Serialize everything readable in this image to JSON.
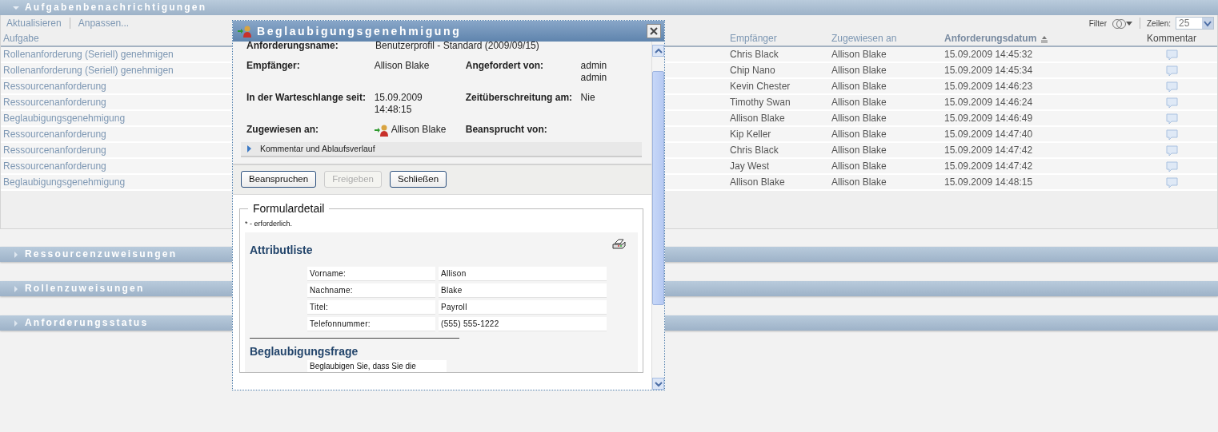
{
  "task_panel": {
    "title": "Aufgabenbenachrichtigungen",
    "expanded": true,
    "toolbar": [
      "Aktualisieren",
      "Anpassen..."
    ],
    "filter_label": "Filter",
    "rows_label": "Zeilen:",
    "rows_value": "25",
    "columns": [
      {
        "label": "Aufgabe",
        "kind": "sortable",
        "sorted": false
      },
      {
        "label": "Empfänger",
        "kind": "sortable",
        "sorted": false
      },
      {
        "label": "Zugewiesen an",
        "kind": "sortable",
        "sorted": false
      },
      {
        "label": "Anforderungsdatum",
        "kind": "sortable",
        "sorted": true
      },
      {
        "label": "Kommentar",
        "kind": "plain",
        "sorted": false
      }
    ],
    "rows": [
      {
        "task": "Rollenanforderung (Seriell) genehmigen",
        "recipient": "Chris Black",
        "assigned_to": "Allison Blake",
        "date": "15.09.2009 14:45:32"
      },
      {
        "task": "Rollenanforderung (Seriell) genehmigen",
        "recipient": "Chip Nano",
        "assigned_to": "Allison Blake",
        "date": "15.09.2009 14:45:34"
      },
      {
        "task": "Ressourcenanforderung",
        "recipient": "Kevin Chester",
        "assigned_to": "Allison Blake",
        "date": "15.09.2009 14:46:23"
      },
      {
        "task": "Ressourcenanforderung",
        "recipient": "Timothy Swan",
        "assigned_to": "Allison Blake",
        "date": "15.09.2009 14:46:24"
      },
      {
        "task": "Beglaubigungsgenehmigung",
        "recipient": "Allison Blake",
        "assigned_to": "Allison Blake",
        "date": "15.09.2009 14:46:49"
      },
      {
        "task": "Ressourcenanforderung",
        "recipient": "Kip Keller",
        "assigned_to": "Allison Blake",
        "date": "15.09.2009 14:47:40"
      },
      {
        "task": "Ressourcenanforderung",
        "recipient": "Chris Black",
        "assigned_to": "Allison Blake",
        "date": "15.09.2009 14:47:42"
      },
      {
        "task": "Ressourcenanforderung",
        "recipient": "Jay West",
        "assigned_to": "Allison Blake",
        "date": "15.09.2009 14:47:42"
      },
      {
        "task": "Beglaubigungsgenehmigung",
        "recipient": "Allison Blake",
        "assigned_to": "Allison Blake",
        "date": "15.09.2009 14:48:15"
      }
    ]
  },
  "collapsed_panels": [
    {
      "title": "Ressourcenzuweisungen",
      "expanded": false
    },
    {
      "title": "Rollenzuweisungen",
      "expanded": false
    },
    {
      "title": "Anforderungsstatus",
      "expanded": false
    }
  ],
  "dialog": {
    "title": "Beglaubigungsgenehmigung",
    "request_name": {
      "label": "Anforderungsname:",
      "value": "Benutzerprofil - Standard (2009/09/15)"
    },
    "details": [
      [
        {
          "label": "Empfänger:",
          "lines": [
            "Allison Blake"
          ],
          "kind": "text"
        },
        {
          "label": "Angefordert von:",
          "lines": [
            "admin",
            "admin"
          ],
          "kind": "text"
        }
      ],
      [
        {
          "label": "In der Warteschlange seit:",
          "lines": [
            "15.09.2009",
            "14:48:15"
          ],
          "kind": "text"
        },
        {
          "label": "Zeitüberschreitung am:",
          "lines": [
            "Nie"
          ],
          "kind": "text"
        }
      ],
      [
        {
          "label": "Zugewiesen an:",
          "lines": [
            "Allison Blake"
          ],
          "kind": "user"
        },
        {
          "label": "Beansprucht von:",
          "kind": "text"
        }
      ]
    ],
    "history": {
      "label": "Kommentar und Ablaufsverlauf",
      "expanded": false
    },
    "buttons": [
      {
        "label": "Beanspruchen",
        "disabled": false
      },
      {
        "label": "Freigeben",
        "disabled": true
      },
      {
        "label": "Schließen",
        "disabled": false
      }
    ],
    "form": {
      "legend": "Formulardetail",
      "note": "* - erforderlich.",
      "attributes_heading": "Attributliste",
      "attributes": [
        {
          "label": "Vorname:",
          "value": "Allison"
        },
        {
          "label": "Nachname:",
          "value": "Blake"
        },
        {
          "label": "Titel:",
          "value": "Payroll"
        },
        {
          "label": "Telefonnummer:",
          "value": "(555) 555-1222"
        }
      ],
      "question_heading": "Beglaubigungsfrage",
      "question_text": "Beglaubigen Sie, dass Sie die"
    }
  }
}
